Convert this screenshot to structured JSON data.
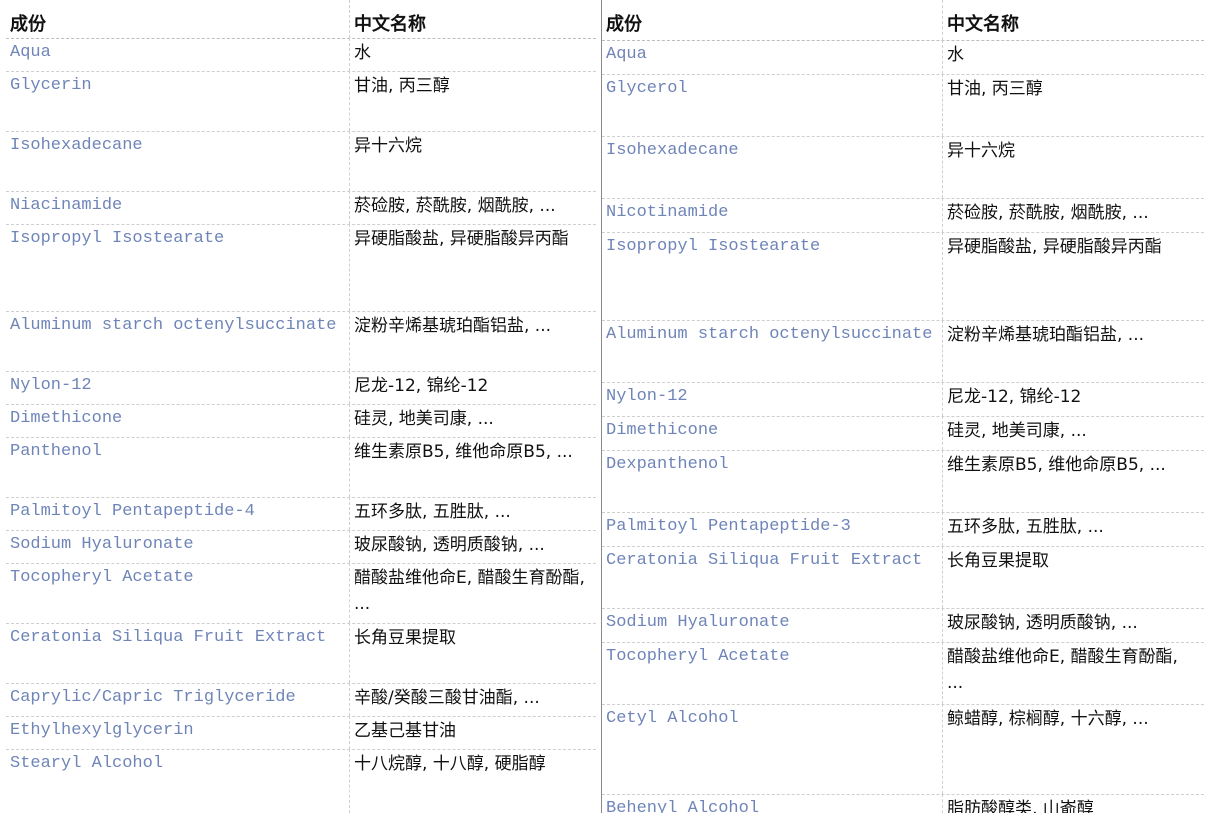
{
  "left_table": {
    "headers": {
      "ingredient": "成份",
      "chinese_name": "中文名称"
    },
    "rows": [
      {
        "ingredient": "Aqua",
        "chinese_name": "水"
      },
      {
        "ingredient": "Glycerin",
        "chinese_name": "甘油, 丙三醇"
      },
      {
        "ingredient": "Isohexadecane",
        "chinese_name": "异十六烷"
      },
      {
        "ingredient": "Niacinamide",
        "chinese_name": "菸硷胺, 菸酰胺, 烟酰胺, ..."
      },
      {
        "ingredient": "Isopropyl Isostearate",
        "chinese_name": "异硬脂酸盐, 异硬脂酸异丙酯"
      },
      {
        "ingredient": "Aluminum starch octenylsuccinate",
        "chinese_name": "淀粉辛烯基琥珀酯铝盐, ..."
      },
      {
        "ingredient": "Nylon-12",
        "chinese_name": "尼龙-12, 锦纶-12"
      },
      {
        "ingredient": "Dimethicone",
        "chinese_name": "硅灵, 地美司康, ..."
      },
      {
        "ingredient": "Panthenol",
        "chinese_name": "维生素原B5, 维他命原B5, ..."
      },
      {
        "ingredient": "Palmitoyl Pentapeptide-4",
        "chinese_name": "五环多肽, 五胜肽, ..."
      },
      {
        "ingredient": "Sodium Hyaluronate",
        "chinese_name": "玻尿酸钠, 透明质酸钠, ..."
      },
      {
        "ingredient": "Tocopheryl Acetate",
        "chinese_name": "醋酸盐维他命E, 醋酸生育酚酯, ..."
      },
      {
        "ingredient": "Ceratonia Siliqua Fruit Extract",
        "chinese_name": "长角豆果提取"
      },
      {
        "ingredient": "Caprylic/Capric Triglyceride",
        "chinese_name": "辛酸/癸酸三酸甘油酯, ..."
      },
      {
        "ingredient": "Ethylhexylglycerin",
        "chinese_name": "乙基己基甘油"
      },
      {
        "ingredient": "Stearyl Alcohol",
        "chinese_name": "十八烷醇, 十八醇, 硬脂醇"
      }
    ]
  },
  "right_table": {
    "headers": {
      "ingredient": "成份",
      "chinese_name": "中文名称"
    },
    "rows": [
      {
        "ingredient": "Aqua",
        "chinese_name": "水"
      },
      {
        "ingredient": "Glycerol",
        "chinese_name": "甘油, 丙三醇"
      },
      {
        "ingredient": "Isohexadecane",
        "chinese_name": "异十六烷"
      },
      {
        "ingredient": "Nicotinamide",
        "chinese_name": "菸硷胺, 菸酰胺, 烟酰胺, ..."
      },
      {
        "ingredient": "Isopropyl Isostearate",
        "chinese_name": "异硬脂酸盐, 异硬脂酸异丙酯"
      },
      {
        "ingredient": "Aluminum starch octenylsuccinate",
        "chinese_name": "淀粉辛烯基琥珀酯铝盐, ..."
      },
      {
        "ingredient": "Nylon-12",
        "chinese_name": "尼龙-12, 锦纶-12"
      },
      {
        "ingredient": "Dimethicone",
        "chinese_name": "硅灵, 地美司康, ..."
      },
      {
        "ingredient": "Dexpanthenol",
        "chinese_name": "维生素原B5, 维他命原B5, ..."
      },
      {
        "ingredient": "Palmitoyl Pentapeptide-3",
        "chinese_name": "五环多肽, 五胜肽, ..."
      },
      {
        "ingredient": "Ceratonia Siliqua Fruit Extract",
        "chinese_name": "长角豆果提取"
      },
      {
        "ingredient": "Sodium Hyaluronate",
        "chinese_name": "玻尿酸钠, 透明质酸钠, ..."
      },
      {
        "ingredient": "Tocopheryl Acetate",
        "chinese_name": "醋酸盐维他命E, 醋酸生育酚酯, ..."
      },
      {
        "ingredient": "Cetyl Alcohol",
        "chinese_name": "鲸蜡醇, 棕榈醇, 十六醇, ..."
      },
      {
        "ingredient": "Behenyl Alcohol",
        "chinese_name": "脂肪酸醇类, 山嵛醇"
      }
    ]
  }
}
